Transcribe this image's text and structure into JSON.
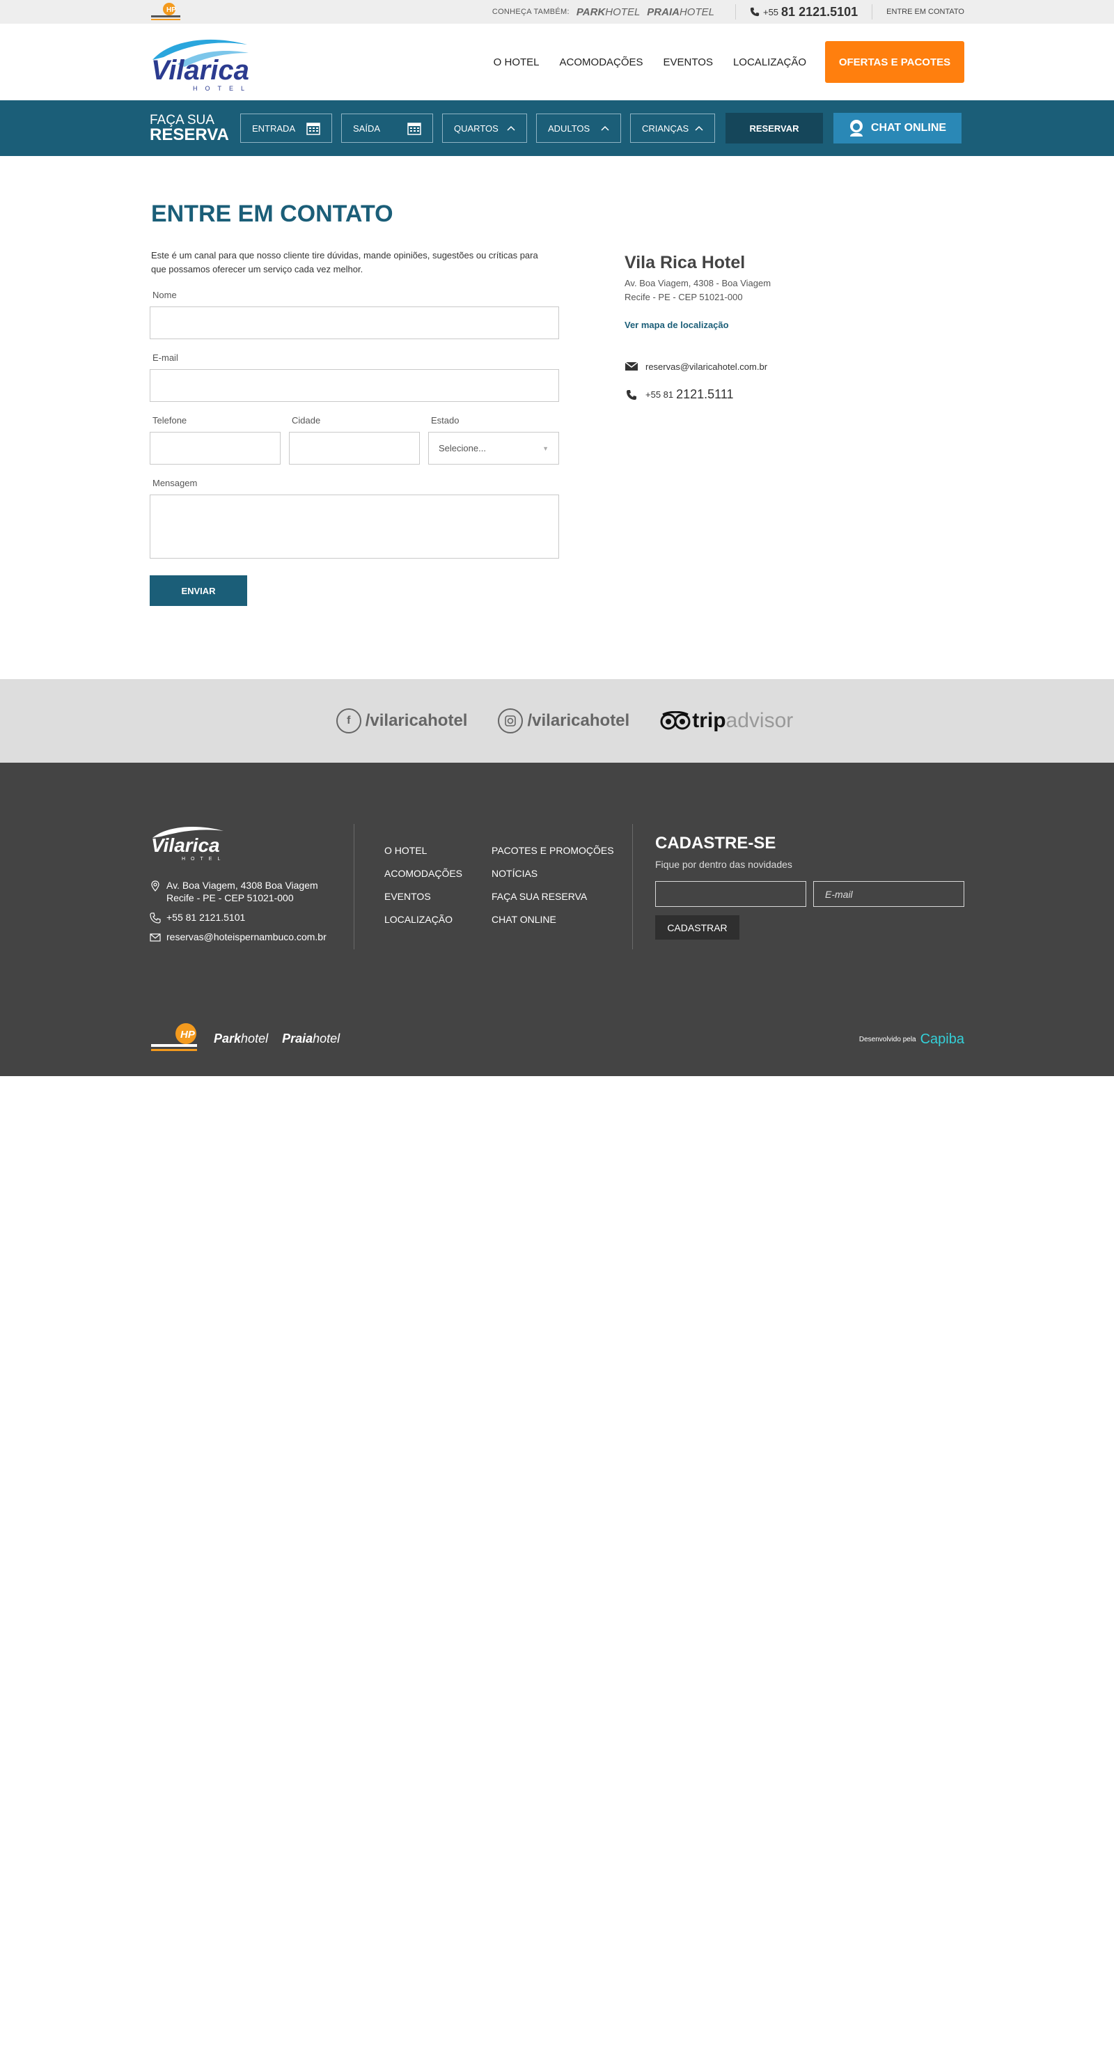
{
  "topbar": {
    "conheca": "CONHEÇA TAMBÉM:",
    "park_bold": "Park",
    "park_thin": "hotel",
    "praia_bold": "Praia",
    "praia_thin": "hotel",
    "phone_prefix": "+55",
    "phone_number": "81 2121.5101",
    "contato_link": "ENTRE EM CONTATO"
  },
  "nav": {
    "items": [
      "O HOTEL",
      "ACOMODAÇÕES",
      "EVENTOS",
      "LOCALIZAÇÃO"
    ],
    "cta": "OFERTAS E PACOTES"
  },
  "reserva": {
    "title_line1": "FAÇA SUA",
    "title_line2": "RESERVA",
    "entrada": "ENTRADA",
    "saida": "SAÍDA",
    "quartos": "QUARTOS",
    "adultos": "ADULTOS",
    "criancas": "CRIANÇAS",
    "reservar": "RESERVAR",
    "chat": "CHAT ONLINE"
  },
  "contact": {
    "title": "ENTRE EM CONTATO",
    "intro": "Este é um canal para que nosso cliente tire dúvidas, mande opiniões, sugestões ou críticas para que possamos oferecer um serviço cada vez melhor.",
    "labels": {
      "nome": "Nome",
      "email": "E-mail",
      "telefone": "Telefone",
      "cidade": "Cidade",
      "estado": "Estado",
      "mensagem": "Mensagem"
    },
    "estado_placeholder": "Selecione...",
    "submit": "ENVIAR"
  },
  "hotel": {
    "name": "Vila Rica Hotel",
    "addr1": "Av. Boa Viagem, 4308 - Boa Viagem",
    "addr2": "Recife - PE - CEP 51021-000",
    "map_link": "Ver mapa de localização",
    "email": "reservas@vilaricahotel.com.br",
    "phone_prefix": "+55 81",
    "phone_number": "2121.5111"
  },
  "social": {
    "facebook": "/vilaricahotel",
    "instagram": "/vilaricahotel",
    "trip1": "trip",
    "trip2": "advisor"
  },
  "footer": {
    "addr1": "Av. Boa Viagem, 4308 Boa Viagem",
    "addr2": "Recife - PE - CEP 51021-000",
    "phone": "+55 81 2121.5101",
    "email": "reservas@hoteispernambuco.com.br",
    "menu_col1": [
      "O HOTEL",
      "ACOMODAÇÕES",
      "EVENTOS",
      "LOCALIZAÇÃO"
    ],
    "menu_col2": [
      "PACOTES E PROMOÇÕES",
      "NOTÍCIAS",
      "FAÇA SUA RESERVA",
      "CHAT ONLINE"
    ],
    "news_title": "CADASTRE-SE",
    "news_sub": "Fique por dentro das novidades",
    "email_placeholder": "E-mail",
    "news_button": "CADASTRAR",
    "park_bold": "Park",
    "park_thin": "hotel",
    "praia_bold": "Praia",
    "praia_thin": "hotel",
    "dev_label": "Desenvolvido pela",
    "dev_name": "Capiba"
  },
  "colors": {
    "primary": "#1b5e78",
    "accent": "#ff7f0e",
    "chat": "#2a88b6",
    "footer": "#444444"
  }
}
